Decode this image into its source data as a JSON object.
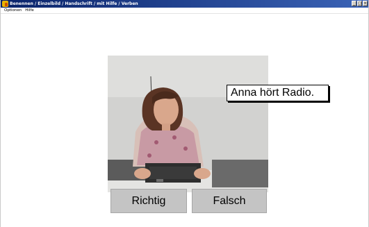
{
  "window": {
    "title": "Benennen / Einzelbild / Handschrift / mit Hilfe / Verben",
    "controls": {
      "minimize": "_",
      "maximize": "□",
      "close": "×"
    }
  },
  "menu": {
    "items": [
      "Optionen",
      "Hilfe"
    ]
  },
  "exercise": {
    "image_icon": "woman-radio-photo",
    "caption": "Anna hört Radio."
  },
  "buttons": {
    "correct": "Richtig",
    "wrong": "Falsch"
  },
  "colors": {
    "titlebar_start": "#0a246a",
    "titlebar_end": "#3b63b6",
    "button_bg": "#c4c4c4"
  }
}
